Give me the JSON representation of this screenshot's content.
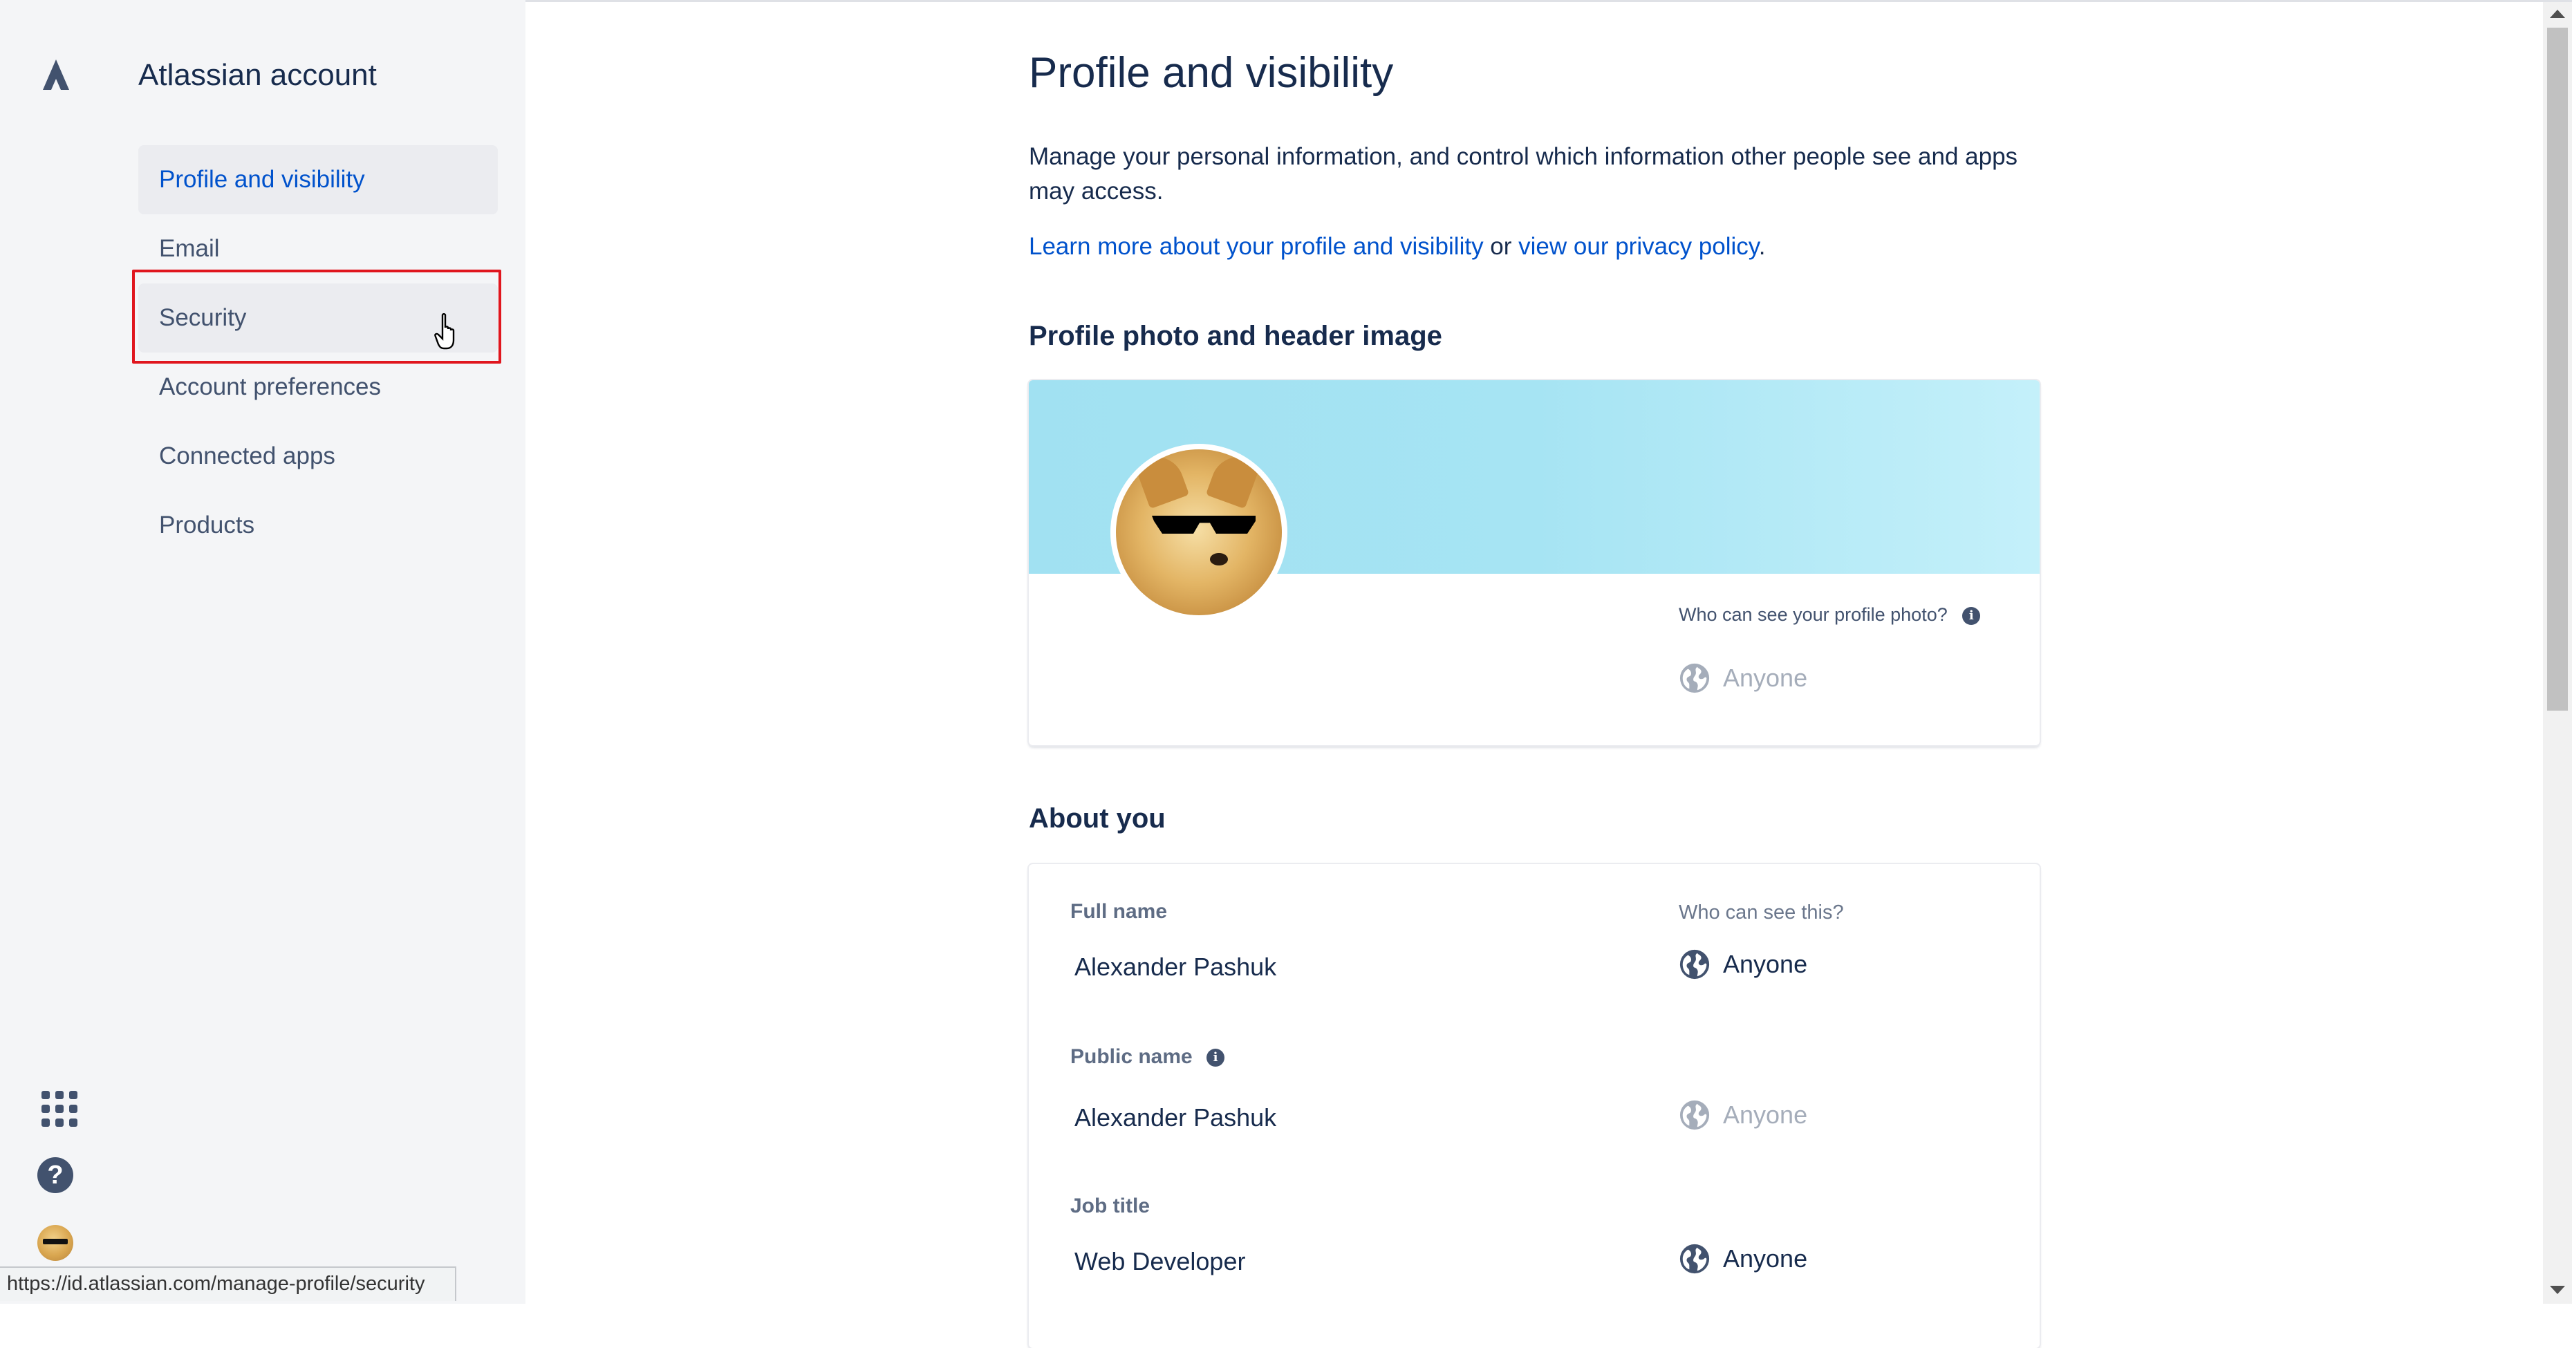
{
  "sidebar": {
    "title": "Atlassian account",
    "items": [
      {
        "label": "Profile and visibility"
      },
      {
        "label": "Email"
      },
      {
        "label": "Security"
      },
      {
        "label": "Account preferences"
      },
      {
        "label": "Connected apps"
      },
      {
        "label": "Products"
      }
    ]
  },
  "status_bar": {
    "url": "https://id.atlassian.com/manage-profile/security"
  },
  "main": {
    "title": "Profile and visibility",
    "intro": "Manage your personal information, and control which information other people see and apps may access.",
    "learn_link": "Learn more about your profile and visibility",
    "or_text": " or ",
    "privacy_link": "view our privacy policy",
    "period": "."
  },
  "photo_section": {
    "title": "Profile photo and header image",
    "visibility_label": "Who can see your profile photo?",
    "visibility_value": "Anyone"
  },
  "about_section": {
    "title": "About you",
    "who_label": "Who can see this?",
    "fields": [
      {
        "label": "Full name",
        "value": "Alexander Pashuk",
        "visibility": "Anyone"
      },
      {
        "label": "Public name",
        "value": "Alexander Pashuk",
        "visibility": "Anyone"
      },
      {
        "label": "Job title",
        "value": "Web Developer",
        "visibility": "Anyone"
      }
    ]
  },
  "colors": {
    "accent": "#0052cc",
    "text": "#172b4d",
    "sidebar_bg": "#f4f5f7",
    "highlight": "#e0161e"
  }
}
